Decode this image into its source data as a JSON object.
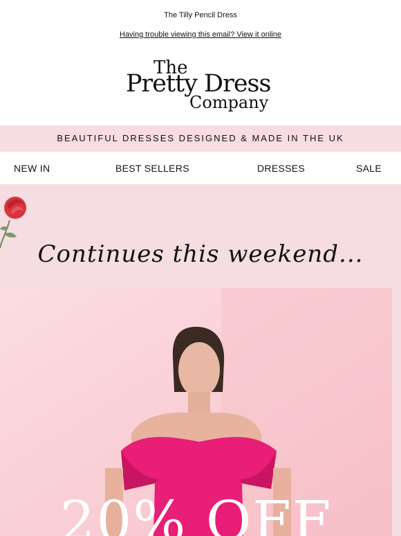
{
  "preheader": {
    "title": "The Tilly Pencil Dress",
    "view_online": "Having trouble viewing this email? View it online"
  },
  "logo": {
    "line1": "The",
    "line2": "Pretty Dress",
    "line3": "Company"
  },
  "banner": {
    "text": "BEAUTIFUL DRESSES DESIGNED & MADE IN THE UK"
  },
  "nav": {
    "items": [
      {
        "label": "NEW IN"
      },
      {
        "label": "BEST SELLERS"
      },
      {
        "label": "DRESSES"
      },
      {
        "label": "SALE"
      }
    ]
  },
  "hero": {
    "script_heading": "Continues this weekend...",
    "offer": "20% OFF"
  },
  "colors": {
    "banner_bg": "#f7dde2",
    "hero_bg": "#f6dde1",
    "dress": "#e91e77",
    "rose": "#d8333f"
  },
  "icons": {
    "rose": "rose-icon"
  }
}
